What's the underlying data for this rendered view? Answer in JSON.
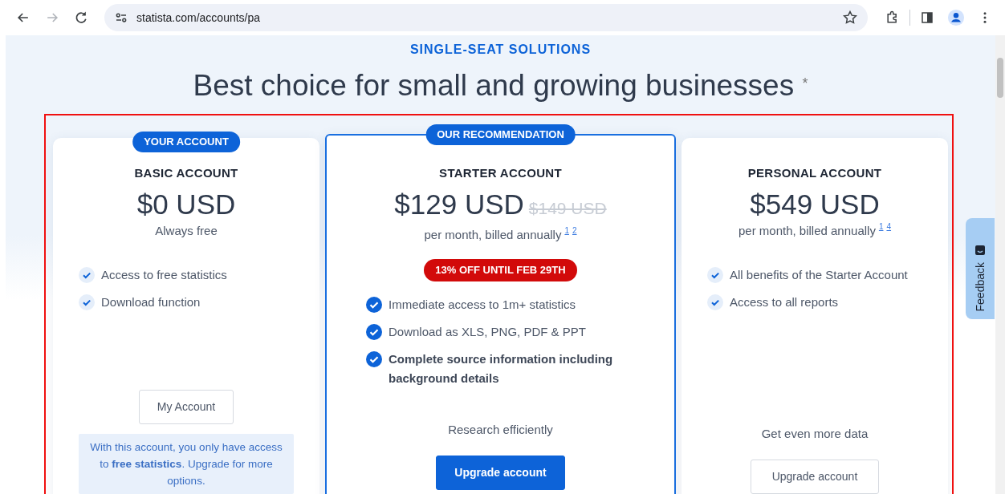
{
  "browser": {
    "nav": [
      {
        "kind": "back",
        "disabled": false
      },
      {
        "kind": "forward",
        "disabled": true
      },
      {
        "kind": "reload",
        "disabled": false
      }
    ],
    "url": "statista.com/accounts/pa"
  },
  "section": {
    "eyebrow": "SINGLE-SEAT SOLUTIONS",
    "heading": "Best choice for small and growing businesses $^{*}$"
  },
  "plans": [
    {
      "badge": "YOUR ACCOUNT",
      "name": "BASIC ACCOUNT",
      "featured": false,
      "price": "$0 USD",
      "subtitle": "Always free",
      "features": [
        {
          "text": "Access to free statistics",
          "bold": false
        },
        {
          "text": "Download function",
          "bold": false
        }
      ],
      "button": {
        "label": "My Account",
        "kind": "outline"
      },
      "note": "With this account, you only have access to **free statistics**. Upgrade for more options."
    },
    {
      "badge": "OUR RECOMMENDATION",
      "name": "STARTER ACCOUNT",
      "featured": true,
      "price": "$129 USD",
      "old_price": "$149 USD",
      "subtitle": "per month, billed annually",
      "footnotes": [
        "1",
        "2"
      ],
      "promo": "13% OFF UNTIL FEB 29TH",
      "features": [
        {
          "text": "Immediate access to 1m+ statistics",
          "bold": false
        },
        {
          "text": "Download as XLS, PNG, PDF & PPT",
          "bold": false
        },
        {
          "text": "Complete source information including background details",
          "bold": true
        }
      ],
      "tagline": "Research efficiently",
      "button": {
        "label": "Upgrade account",
        "kind": "primary"
      }
    },
    {
      "name": "PERSONAL ACCOUNT",
      "featured": false,
      "price": "$549 USD",
      "subtitle": "per month, billed annually",
      "footnotes": [
        "1",
        "4"
      ],
      "features": [
        {
          "text": "All benefits of the Starter Account",
          "bold": false
        },
        {
          "text": "Access to all reports",
          "bold": false
        }
      ],
      "tagline": "Get even more data",
      "button": {
        "label": "Upgrade account",
        "kind": "outline"
      }
    }
  ],
  "feedback": {
    "label": "Feedback"
  }
}
